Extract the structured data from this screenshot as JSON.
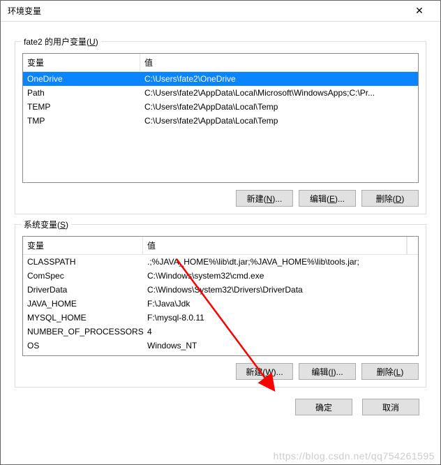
{
  "title": "环境变量",
  "close_glyph": "✕",
  "user_group": {
    "label_prefix": "fate2 的用户变量(",
    "label_accel": "U",
    "label_suffix": ")",
    "col_var": "变量",
    "col_val": "值",
    "rows": [
      {
        "name": "OneDrive",
        "value": "C:\\Users\\fate2\\OneDrive",
        "selected": true
      },
      {
        "name": "Path",
        "value": "C:\\Users\\fate2\\AppData\\Local\\Microsoft\\WindowsApps;C:\\Pr...",
        "selected": false
      },
      {
        "name": "TEMP",
        "value": "C:\\Users\\fate2\\AppData\\Local\\Temp",
        "selected": false
      },
      {
        "name": "TMP",
        "value": "C:\\Users\\fate2\\AppData\\Local\\Temp",
        "selected": false
      }
    ],
    "btn_new": {
      "text": "新建(",
      "accel": "N",
      "suffix": ")..."
    },
    "btn_edit": {
      "text": "编辑(",
      "accel": "E",
      "suffix": ")..."
    },
    "btn_del": {
      "text": "删除(",
      "accel": "D",
      "suffix": ")"
    }
  },
  "sys_group": {
    "label_prefix": "系统变量(",
    "label_accel": "S",
    "label_suffix": ")",
    "col_var": "变量",
    "col_val": "值",
    "rows": [
      {
        "name": "CLASSPATH",
        "value": ".;%JAVA_HOME%\\lib\\dt.jar;%JAVA_HOME%\\lib\\tools.jar;"
      },
      {
        "name": "ComSpec",
        "value": "C:\\Windows\\system32\\cmd.exe"
      },
      {
        "name": "DriverData",
        "value": "C:\\Windows\\System32\\Drivers\\DriverData"
      },
      {
        "name": "JAVA_HOME",
        "value": "F:\\Java\\Jdk"
      },
      {
        "name": "MYSQL_HOME",
        "value": "F:\\mysql-8.0.11"
      },
      {
        "name": "NUMBER_OF_PROCESSORS",
        "value": "4"
      },
      {
        "name": "OS",
        "value": "Windows_NT"
      }
    ],
    "btn_new": {
      "text": "新建(",
      "accel": "W",
      "suffix": ")..."
    },
    "btn_edit": {
      "text": "编辑(",
      "accel": "I",
      "suffix": ")..."
    },
    "btn_del": {
      "text": "删除(",
      "accel": "L",
      "suffix": ")"
    }
  },
  "footer": {
    "ok": "确定",
    "cancel": "取消"
  },
  "watermark": "https://blog.csdn.net/qq754261595"
}
